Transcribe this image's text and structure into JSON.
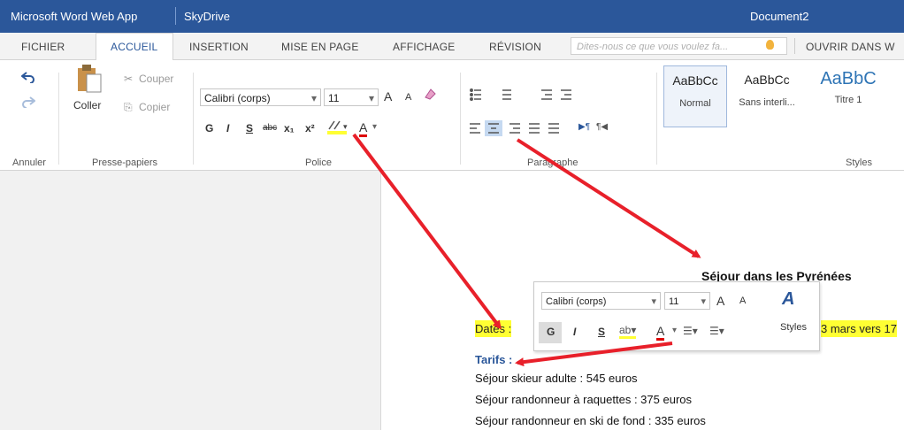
{
  "titlebar": {
    "app": "Microsoft Word Web App",
    "service": "SkyDrive",
    "document": "Document2"
  },
  "tabs": [
    "FICHIER",
    "ACCUEIL",
    "INSERTION",
    "MISE EN PAGE",
    "AFFICHAGE",
    "RÉVISION"
  ],
  "tell_me_placeholder": "Dites-nous ce que vous voulez fa...",
  "open_in": "OUVRIR DANS W",
  "ribbon": {
    "coller": "Coller",
    "couper": "Couper",
    "copier": "Copier",
    "font": "Calibri (corps)",
    "size": "11",
    "groups": {
      "annuler": "Annuler",
      "presse": "Presse-papiers",
      "police": "Police",
      "paragraphe": "Paragraphe",
      "styles": "Styles"
    },
    "fmt": {
      "bold": "G",
      "italic": "I",
      "underline": "S",
      "strike": "abc",
      "sub": "x₁",
      "sup": "x²",
      "grow": "A",
      "shrink": "A",
      "color": "A"
    },
    "styles": [
      {
        "sample": "AaBbCc",
        "name": "Normal"
      },
      {
        "sample": "AaBbCc",
        "name": "Sans interli..."
      },
      {
        "sample": "AaBbC",
        "name": "Titre 1"
      }
    ]
  },
  "document": {
    "title": "Séjour dans les Pyrénées",
    "dates_label": "Dates : ",
    "dates_tail": "3 mars vers 17",
    "tarifs": "Tarifs :",
    "lines": [
      "Séjour skieur adulte : 545 euros",
      "Séjour randonneur à raquettes : 375 euros",
      "Séjour randonneur en ski de fond : 335 euros"
    ]
  },
  "minibar": {
    "font": "Calibri (corps)",
    "size": "11",
    "styles": "Styles",
    "bold": "G",
    "italic": "I",
    "underline": "S"
  },
  "colors": {
    "title_bar": "#2b579a",
    "accent": "#2b579a",
    "highlight": "#ffff33",
    "arrow": "#e8202a"
  }
}
